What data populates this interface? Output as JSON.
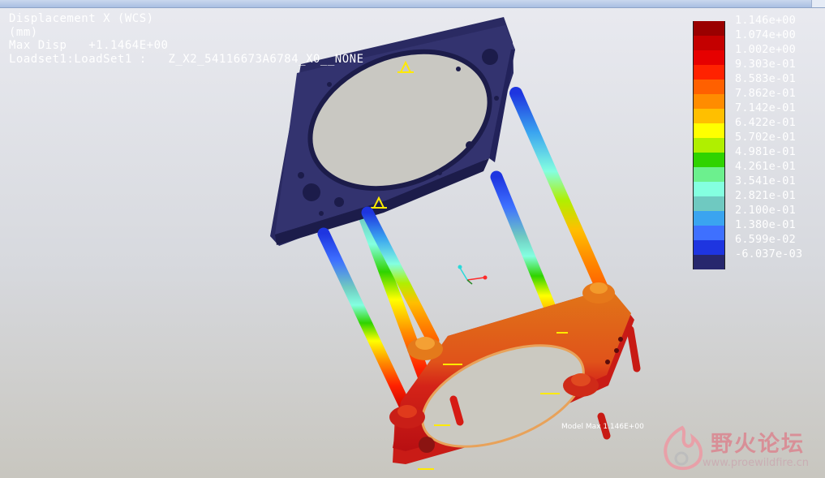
{
  "result_header": {
    "line1": "Displacement X (WCS)",
    "line2": "(mm)",
    "line3": "Max Disp   +1.1464E+00",
    "line4": "Loadset1:LoadSet1 :   Z_X2_54116673A6784_X0__NONE"
  },
  "legend": {
    "entries": [
      {
        "label": "1.146e+00",
        "color": "#9a0000"
      },
      {
        "label": "1.074e+00",
        "color": "#c40000"
      },
      {
        "label": "1.002e+00",
        "color": "#e60000"
      },
      {
        "label": "9.303e-01",
        "color": "#ff2200"
      },
      {
        "label": "8.583e-01",
        "color": "#ff6000"
      },
      {
        "label": "7.862e-01",
        "color": "#ff8c00"
      },
      {
        "label": "7.142e-01",
        "color": "#ffbf00"
      },
      {
        "label": "6.422e-01",
        "color": "#ffff00"
      },
      {
        "label": "5.702e-01",
        "color": "#b0ef00"
      },
      {
        "label": "4.981e-01",
        "color": "#2fd300"
      },
      {
        "label": "4.261e-01",
        "color": "#6cf08e"
      },
      {
        "label": "3.541e-01",
        "color": "#84ffe0"
      },
      {
        "label": "2.821e-01",
        "color": "#6fc9c1"
      },
      {
        "label": "2.100e-01",
        "color": "#3aa4f0"
      },
      {
        "label": "1.380e-01",
        "color": "#3e70ff"
      },
      {
        "label": "6.599e-02",
        "color": "#1e35e0"
      },
      {
        "label": "-6.037e-03",
        "color": "#27276d"
      }
    ]
  },
  "model": {
    "model_max_label": "Model Max  1.146E+00",
    "plate_color": "#33336f",
    "plate_edge_color": "#1c1c4a"
  },
  "watermark": {
    "title": "野火论坛",
    "url": "www.proewildfire.cn"
  }
}
